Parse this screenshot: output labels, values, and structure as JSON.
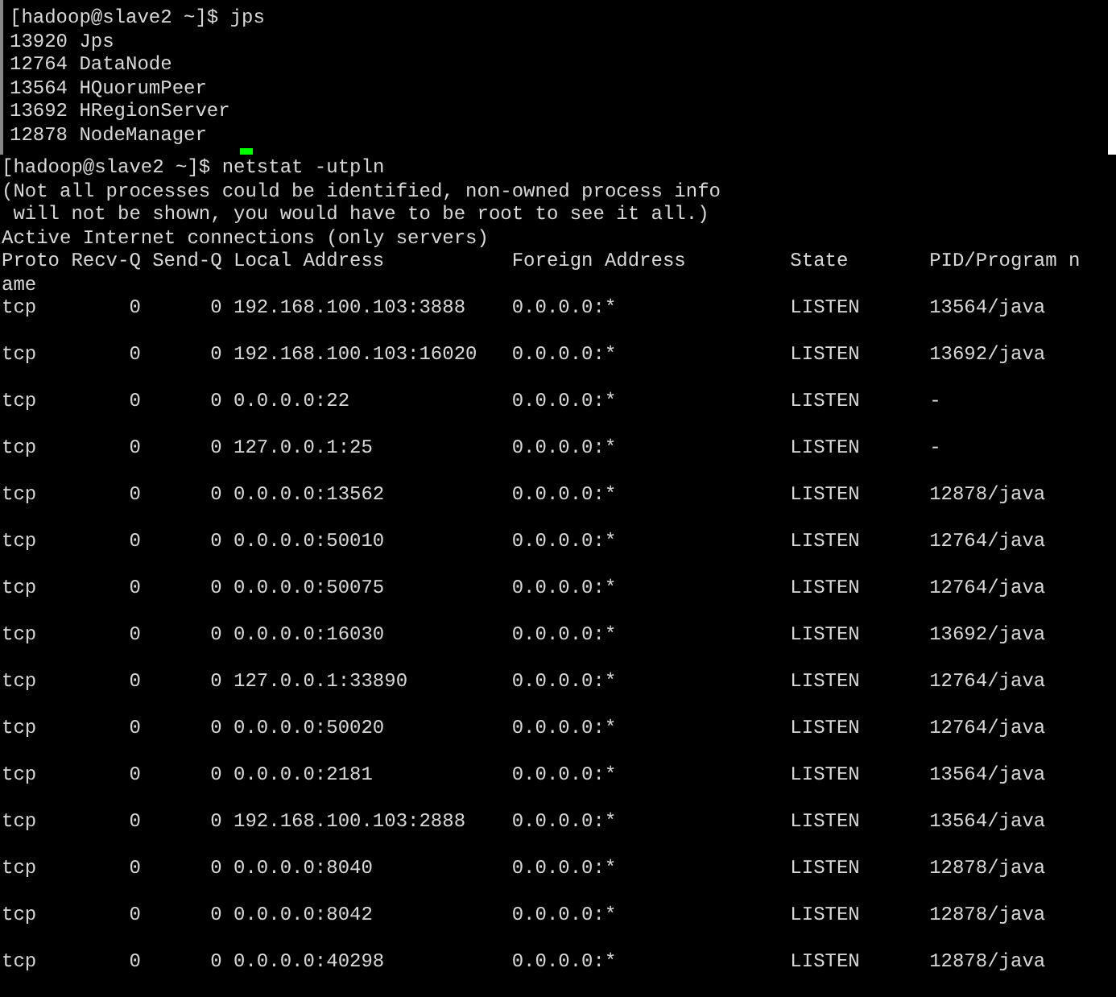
{
  "jps_terminal": {
    "lines": [
      "[hadoop@slave2 ~]$ jps",
      "13920 Jps",
      "12764 DataNode",
      "13564 HQuorumPeer",
      "13692 HRegionServer",
      "12878 NodeManager"
    ],
    "cursor": true
  },
  "netstat_terminal": {
    "lines": [
      "[hadoop@slave2 ~]$ netstat -utpln",
      "(Not all processes could be identified, non-owned process info",
      " will not be shown, you would have to be root to see it all.)",
      "Active Internet connections (only servers)"
    ],
    "columns": [
      "Proto",
      "Recv-Q",
      "Send-Q",
      "Local Address",
      "Foreign Address",
      "State",
      "PID/Program n"
    ],
    "header_wrap": "ame",
    "rows": [
      {
        "proto": "tcp",
        "recv_q": "0",
        "send_q": "0",
        "local": "192.168.100.103:3888",
        "foreign": "0.0.0.0:*",
        "state": "LISTEN",
        "pid": "13564/java"
      },
      {
        "proto": "tcp",
        "recv_q": "0",
        "send_q": "0",
        "local": "192.168.100.103:16020",
        "foreign": "0.0.0.0:*",
        "state": "LISTEN",
        "pid": "13692/java"
      },
      {
        "proto": "tcp",
        "recv_q": "0",
        "send_q": "0",
        "local": "0.0.0.0:22",
        "foreign": "0.0.0.0:*",
        "state": "LISTEN",
        "pid": "-"
      },
      {
        "proto": "tcp",
        "recv_q": "0",
        "send_q": "0",
        "local": "127.0.0.1:25",
        "foreign": "0.0.0.0:*",
        "state": "LISTEN",
        "pid": "-"
      },
      {
        "proto": "tcp",
        "recv_q": "0",
        "send_q": "0",
        "local": "0.0.0.0:13562",
        "foreign": "0.0.0.0:*",
        "state": "LISTEN",
        "pid": "12878/java"
      },
      {
        "proto": "tcp",
        "recv_q": "0",
        "send_q": "0",
        "local": "0.0.0.0:50010",
        "foreign": "0.0.0.0:*",
        "state": "LISTEN",
        "pid": "12764/java"
      },
      {
        "proto": "tcp",
        "recv_q": "0",
        "send_q": "0",
        "local": "0.0.0.0:50075",
        "foreign": "0.0.0.0:*",
        "state": "LISTEN",
        "pid": "12764/java"
      },
      {
        "proto": "tcp",
        "recv_q": "0",
        "send_q": "0",
        "local": "0.0.0.0:16030",
        "foreign": "0.0.0.0:*",
        "state": "LISTEN",
        "pid": "13692/java"
      },
      {
        "proto": "tcp",
        "recv_q": "0",
        "send_q": "0",
        "local": "127.0.0.1:33890",
        "foreign": "0.0.0.0:*",
        "state": "LISTEN",
        "pid": "12764/java"
      },
      {
        "proto": "tcp",
        "recv_q": "0",
        "send_q": "0",
        "local": "0.0.0.0:50020",
        "foreign": "0.0.0.0:*",
        "state": "LISTEN",
        "pid": "12764/java"
      },
      {
        "proto": "tcp",
        "recv_q": "0",
        "send_q": "0",
        "local": "0.0.0.0:2181",
        "foreign": "0.0.0.0:*",
        "state": "LISTEN",
        "pid": "13564/java"
      },
      {
        "proto": "tcp",
        "recv_q": "0",
        "send_q": "0",
        "local": "192.168.100.103:2888",
        "foreign": "0.0.0.0:*",
        "state": "LISTEN",
        "pid": "13564/java"
      },
      {
        "proto": "tcp",
        "recv_q": "0",
        "send_q": "0",
        "local": "0.0.0.0:8040",
        "foreign": "0.0.0.0:*",
        "state": "LISTEN",
        "pid": "12878/java"
      },
      {
        "proto": "tcp",
        "recv_q": "0",
        "send_q": "0",
        "local": "0.0.0.0:8042",
        "foreign": "0.0.0.0:*",
        "state": "LISTEN",
        "pid": "12878/java"
      },
      {
        "proto": "tcp",
        "recv_q": "0",
        "send_q": "0",
        "local": "0.0.0.0:40298",
        "foreign": "0.0.0.0:*",
        "state": "LISTEN",
        "pid": "12878/java"
      }
    ]
  }
}
